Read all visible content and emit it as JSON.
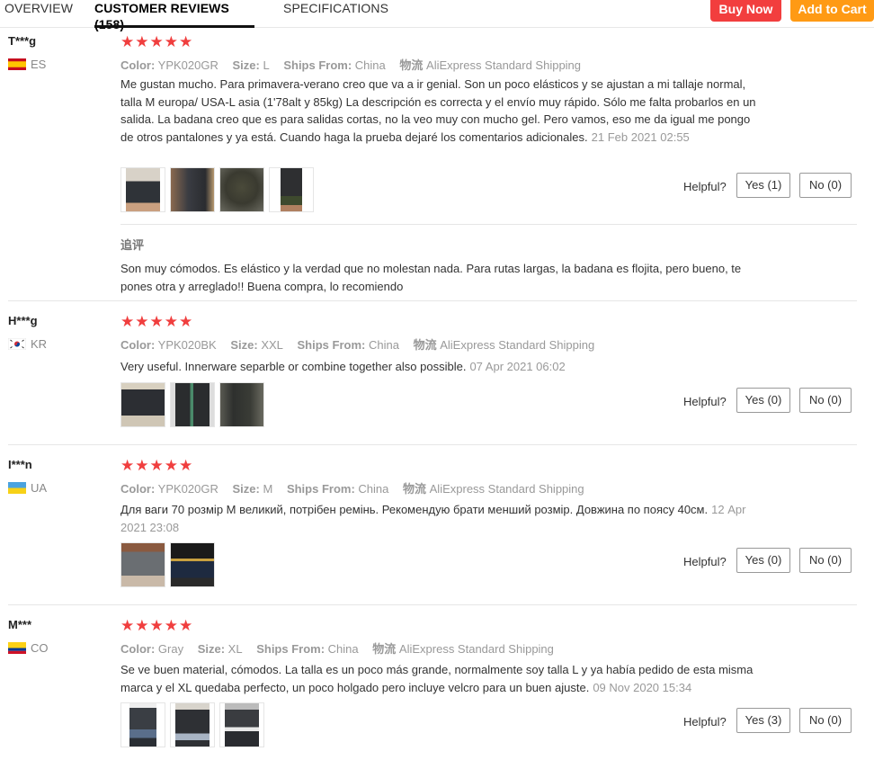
{
  "tabs": [
    {
      "label": "OVERVIEW"
    },
    {
      "label": "CUSTOMER REVIEWS (158)"
    },
    {
      "label": "SPECIFICATIONS"
    }
  ],
  "buy_now_label": "Buy Now",
  "add_to_cart_label": "Add to Cart",
  "colors": {
    "buy_now": "#f23e3e",
    "add_to_cart": "#ff9a14",
    "stars": "#f03e3e"
  },
  "helpful_label": "Helpful?",
  "attr_keys": {
    "color": "Color:",
    "size": "Size:",
    "ships_from": "Ships From:",
    "shipping": "物流"
  },
  "reviews": [
    {
      "name": "T***g",
      "country": "ES",
      "stars": "★★★★★",
      "color": "YPK020GR",
      "size": "L",
      "ships_from": "China",
      "shipping": "AliExpress Standard Shipping",
      "text": "Me gustan mucho. Para primavera-verano creo que va a ir genial. Son un poco elásticos y se ajustan a mi tallaje normal, talla M europa/ USA-L asia (1'78alt y 85kg) La descripción es correcta y el envío muy rápido. Sólo me falta probarlos en un salida. La badana creo que es para salidas cortas, no la veo muy con mucho gel. Pero vamos, eso me da igual me pongo de otros pantalones y ya está. Cuando haga la prueba dejaré los comentarios adicionales.",
      "date": "21 Feb 2021 02:55",
      "yes": "Yes (1)",
      "no": "No (0)",
      "followup_label": "追评",
      "followup_text": "Son muy cómodos. Es elástico y la verdad que no molestan nada. Para rutas largas, la badana es flojita, pero bueno, te pones otra y arreglado!! Buena compra, lo recomiendo"
    },
    {
      "name": "H***g",
      "country": "KR",
      "stars": "★★★★★",
      "color": "YPK020BK",
      "size": "XXL",
      "ships_from": "China",
      "shipping": "AliExpress Standard Shipping",
      "text": "Very useful. Innerware separble or combine together also possible.",
      "date": "07 Apr 2021 06:02",
      "yes": "Yes (0)",
      "no": "No (0)"
    },
    {
      "name": "I***n",
      "country": "UA",
      "stars": "★★★★★",
      "color": "YPK020GR",
      "size": "M",
      "ships_from": "China",
      "shipping": "AliExpress Standard Shipping",
      "text": "Для ваги 70 розмір М великий, потрібен ремінь. Рекомендую брати менший розмір. Довжина по поясу 40см.",
      "date": "12 Apr 2021 23:08",
      "yes": "Yes (0)",
      "no": "No (0)"
    },
    {
      "name": "M***",
      "country": "CO",
      "stars": "★★★★★",
      "color": "Gray",
      "size": "XL",
      "ships_from": "China",
      "shipping": "AliExpress Standard Shipping",
      "text": "Se ve buen material, cómodos. La talla es un poco más grande, normalmente soy talla L y ya había pedido de esta misma marca y el XL quedaba perfecto, un poco holgado pero incluye velcro para un buen ajuste.",
      "date": "09 Nov 2020 15:34",
      "yes": "Yes (3)",
      "no": "No (0)"
    }
  ]
}
